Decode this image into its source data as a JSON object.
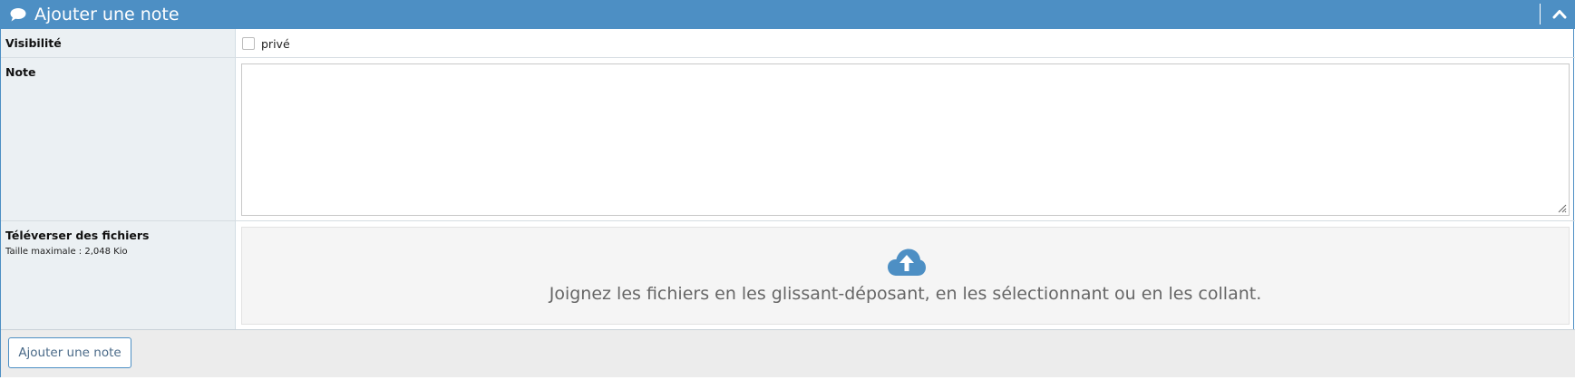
{
  "header": {
    "title": "Ajouter une note",
    "icon": "comment-icon",
    "collapse_icon": "chevron-up-icon",
    "color": "#4d8fc4"
  },
  "visibility": {
    "label": "Visibilité",
    "checkbox_label": "privé",
    "checked": false
  },
  "note": {
    "label": "Note",
    "value": ""
  },
  "upload": {
    "label": "Téléverser des fichiers",
    "max_size": "Taille maximale : 2,048 Kio",
    "icon": "cloud-upload-icon",
    "dropzone_text": "Joignez les fichiers en les glissant-déposant, en les sélectionnant ou en les collant."
  },
  "footer": {
    "submit_label": "Ajouter une note"
  }
}
